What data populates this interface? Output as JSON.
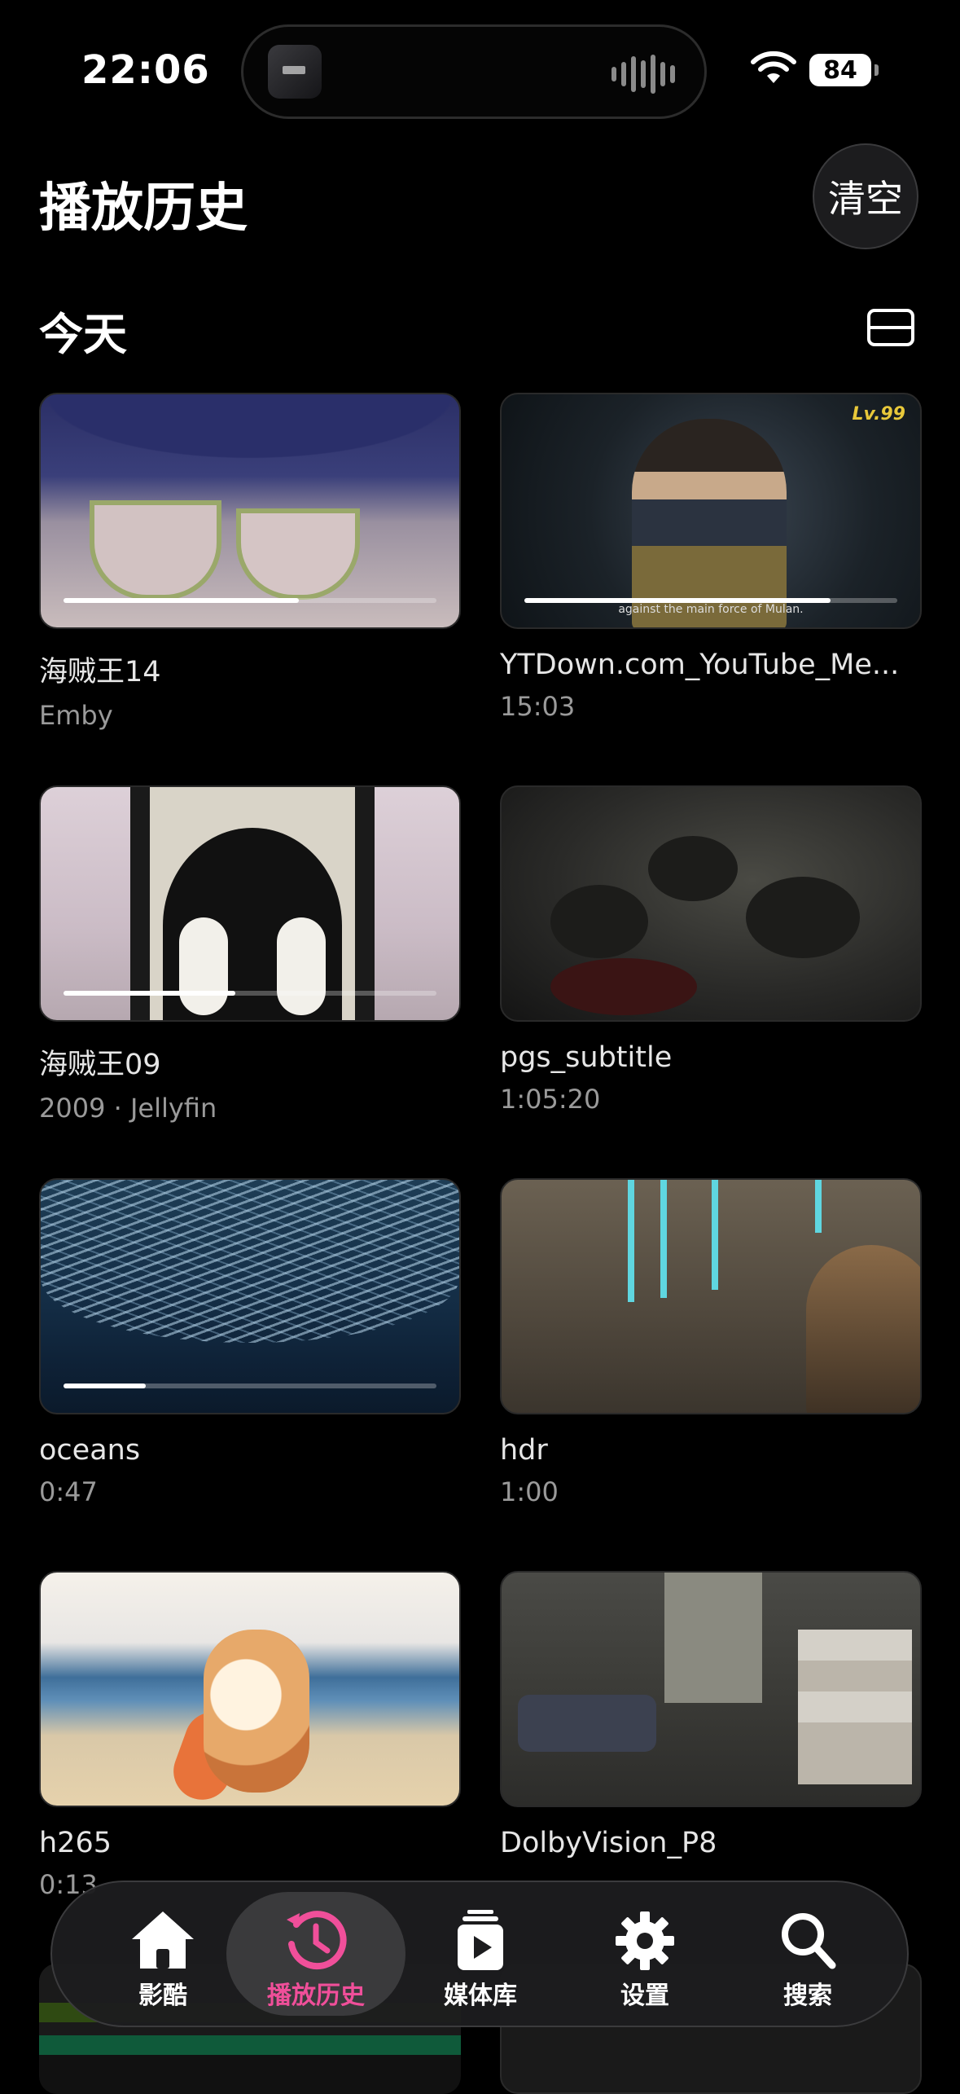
{
  "status": {
    "time": "22:06",
    "battery": "84"
  },
  "header": {
    "title": "播放历史",
    "clear_label": "清空"
  },
  "section": {
    "title": "今天"
  },
  "items": [
    {
      "title": "海贼王14",
      "subtitle": "Emby",
      "progress": 0.63
    },
    {
      "title": "YTDown.com_YouTube_Me...",
      "subtitle": "15:03",
      "progress": 0.82
    },
    {
      "title": "海贼王09",
      "subtitle": "2009 · Jellyfin",
      "progress": 0.46
    },
    {
      "title": "pgs_subtitle",
      "subtitle": "1:05:20",
      "progress": 0
    },
    {
      "title": "oceans",
      "subtitle": "0:47",
      "progress": 0.22
    },
    {
      "title": "hdr",
      "subtitle": "1:00",
      "progress": 0
    },
    {
      "title": "h265",
      "subtitle": "0:13",
      "progress": 0
    },
    {
      "title": "DolbyVision_P8",
      "subtitle": "",
      "progress": 0
    }
  ],
  "thumb_texts": {
    "item2_logo": "Lv.99",
    "item2_caption": "against the main force of Mulan."
  },
  "tabbar": {
    "tabs": [
      {
        "label": "影酷",
        "icon": "home-icon"
      },
      {
        "label": "播放历史",
        "icon": "history-icon",
        "active": true
      },
      {
        "label": "媒体库",
        "icon": "media-library-icon"
      },
      {
        "label": "设置",
        "icon": "gear-icon"
      },
      {
        "label": "搜索",
        "icon": "search-icon"
      }
    ]
  },
  "colors": {
    "accent": "#f04f9a",
    "background": "#000000"
  }
}
